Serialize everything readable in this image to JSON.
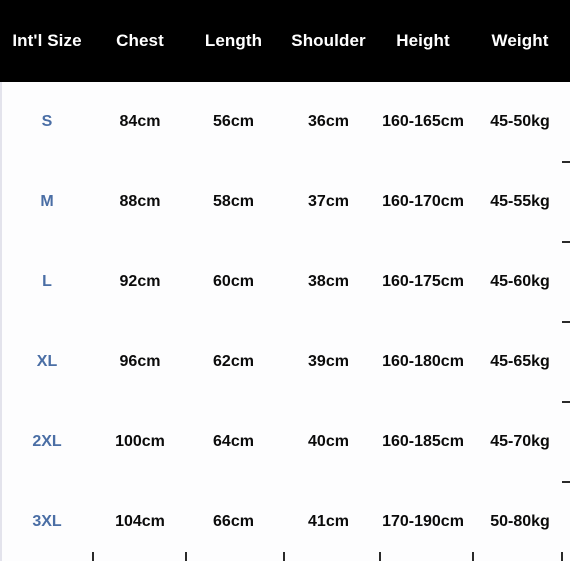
{
  "chart": {
    "title_region": "international-size-chart",
    "colors": {
      "header_background": "#000000",
      "header_text": "#ffffff",
      "body_background": "#fdfdfe",
      "body_text": "#0b0b0b",
      "size_label_accent": "#4a6ea5",
      "edge_line": "#e3e3ec",
      "tick_mark": "#2a2a2a"
    },
    "columns": [
      {
        "key": "size",
        "label": "Int'l Size"
      },
      {
        "key": "chest",
        "label": "Chest"
      },
      {
        "key": "length",
        "label": "Length"
      },
      {
        "key": "shoulder",
        "label": "Shoulder"
      },
      {
        "key": "height",
        "label": "Height"
      },
      {
        "key": "weight",
        "label": "Weight"
      }
    ],
    "rows": [
      {
        "size": "S",
        "chest": "84cm",
        "length": "56cm",
        "shoulder": "36cm",
        "height": "160-165cm",
        "weight": "45-50kg"
      },
      {
        "size": "M",
        "chest": "88cm",
        "length": "58cm",
        "shoulder": "37cm",
        "height": "160-170cm",
        "weight": "45-55kg"
      },
      {
        "size": "L",
        "chest": "92cm",
        "length": "60cm",
        "shoulder": "38cm",
        "height": "160-175cm",
        "weight": "45-60kg"
      },
      {
        "size": "XL",
        "chest": "96cm",
        "length": "62cm",
        "shoulder": "39cm",
        "height": "160-180cm",
        "weight": "45-65kg"
      },
      {
        "size": "2XL",
        "chest": "100cm",
        "length": "64cm",
        "shoulder": "40cm",
        "height": "160-185cm",
        "weight": "45-70kg"
      },
      {
        "size": "3XL",
        "chest": "104cm",
        "length": "66cm",
        "shoulder": "41cm",
        "height": "170-190cm",
        "weight": "50-80kg"
      }
    ]
  }
}
